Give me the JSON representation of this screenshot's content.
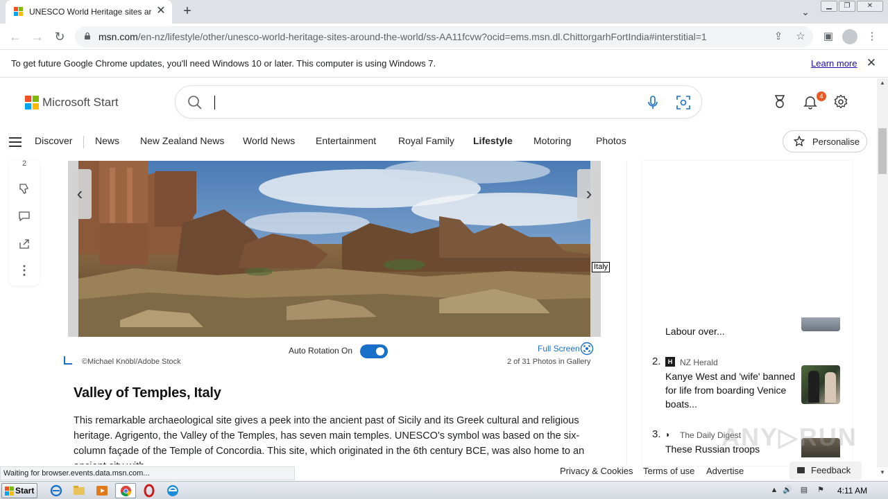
{
  "browser": {
    "tab_title": "UNESCO World Heritage sites aroun",
    "url_host": "msn.com",
    "url_path": "/en-nz/lifestyle/other/unesco-world-heritage-sites-around-the-world/ss-AA11fcvw?ocid=ems.msn.dl.ChittorgarhFortIndia#interstitial=1",
    "infobar_message": "To get future Google Chrome updates, you'll need Windows 10 or later. This computer is using Windows 7.",
    "infobar_link": "Learn more",
    "status_text": "Waiting for browser.events.data.msn.com..."
  },
  "header": {
    "logo_text": "Microsoft Start",
    "notification_count": "4"
  },
  "nav": {
    "items": [
      "Discover",
      "News",
      "New Zealand News",
      "World News",
      "Entertainment",
      "Royal Family",
      "Lifestyle",
      "Motoring",
      "Photos"
    ],
    "active": "Lifestyle",
    "personalise_label": "Personalise"
  },
  "side_actions": {
    "count": "2"
  },
  "gallery": {
    "tooltip": "Italy",
    "auto_rotation_label": "Auto Rotation On",
    "auto_rotation_on": true,
    "full_screen_label": "Full Screen",
    "credit": "©Michael Knöbl/Adobe Stock",
    "photo_count": "2 of 31 Photos in Gallery"
  },
  "article": {
    "heading": "Valley of Temples, Italy",
    "body": "This remarkable archaeological site gives a peek into the ancient past of Sicily and its Greek cultural and religious heritage. Agrigento, the Valley of the Temples, has seven main temples. UNESCO's symbol was based on the six-column façade of the Temple of Concordia. This site, which originated in the 6th century BCE, was also home to an ancient city with"
  },
  "rail": {
    "items": [
      {
        "number": "",
        "source": "",
        "title": "Labour over..."
      },
      {
        "number": "2.",
        "source": "NZ Herald",
        "title": "Kanye West and 'wife' banned for life from boarding Venice boats..."
      },
      {
        "number": "3.",
        "source": "The Daily Digest",
        "title": "These Russian troops"
      }
    ]
  },
  "footer": {
    "privacy": "Privacy & Cookies",
    "terms": "Terms of use",
    "advertise": "Advertise",
    "feedback": "Feedback"
  },
  "taskbar": {
    "start_label": "Start",
    "clock": "4:11 AM"
  },
  "colors": {
    "accent": "#1a6fc9",
    "badge": "#e85a24"
  }
}
